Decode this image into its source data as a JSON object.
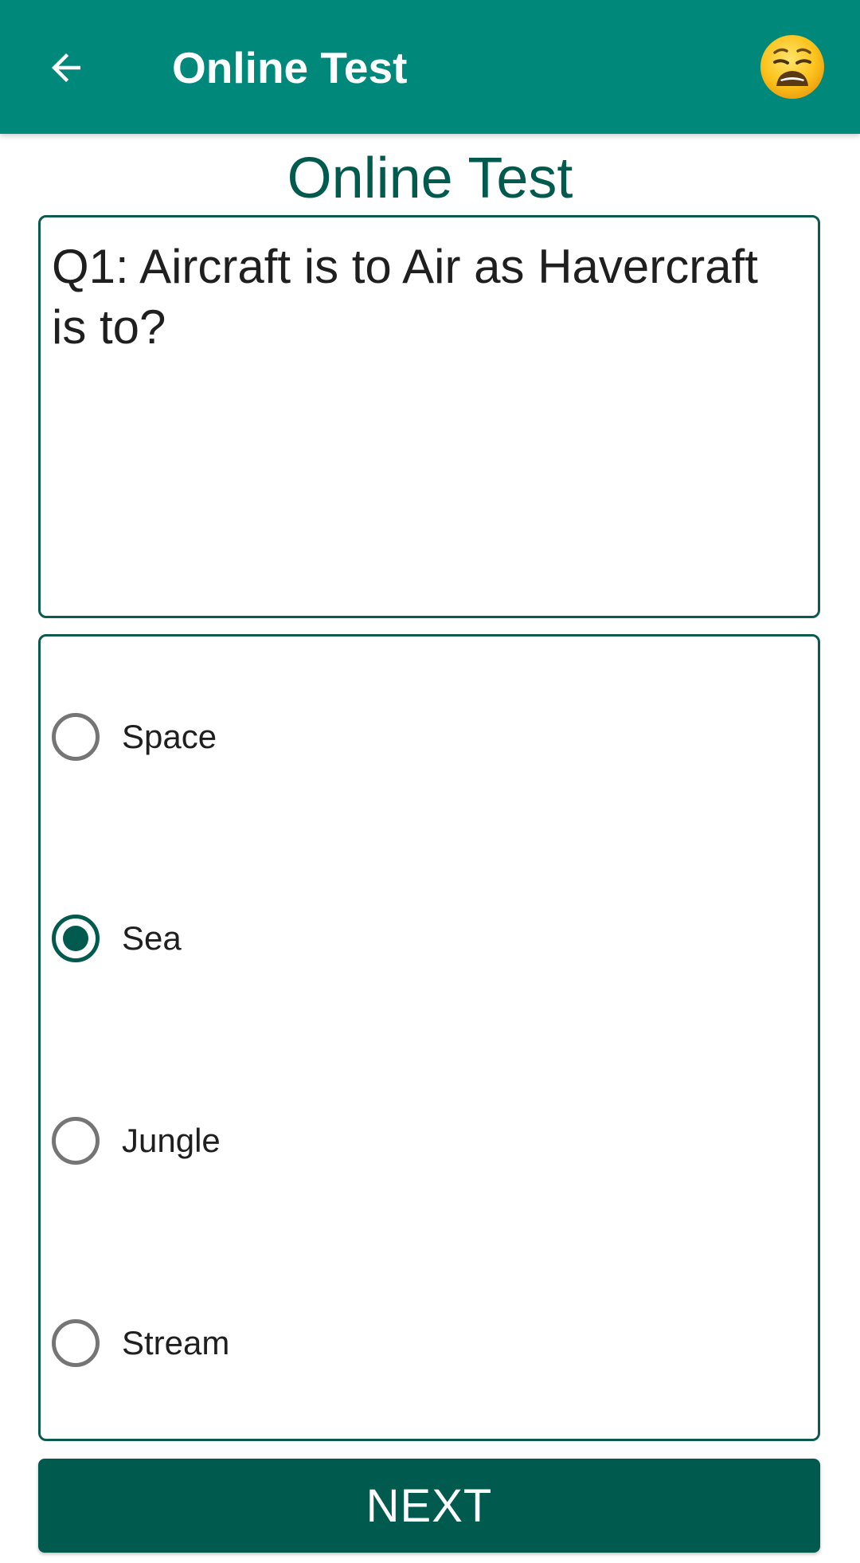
{
  "app_bar": {
    "title": "Online Test",
    "back_icon": "arrow-left-icon",
    "status_icon": "weary-face-emoji-icon",
    "background_color": "#00897b"
  },
  "page": {
    "heading": "Online Test"
  },
  "question": {
    "text": "Q1: Aircraft is to Air as Havercraft is to?"
  },
  "options": [
    {
      "label": "Space",
      "selected": false
    },
    {
      "label": "Sea",
      "selected": true
    },
    {
      "label": "Jungle",
      "selected": false
    },
    {
      "label": "Stream",
      "selected": false
    }
  ],
  "next_button": {
    "label": "NEXT",
    "color": "#005a4e"
  }
}
